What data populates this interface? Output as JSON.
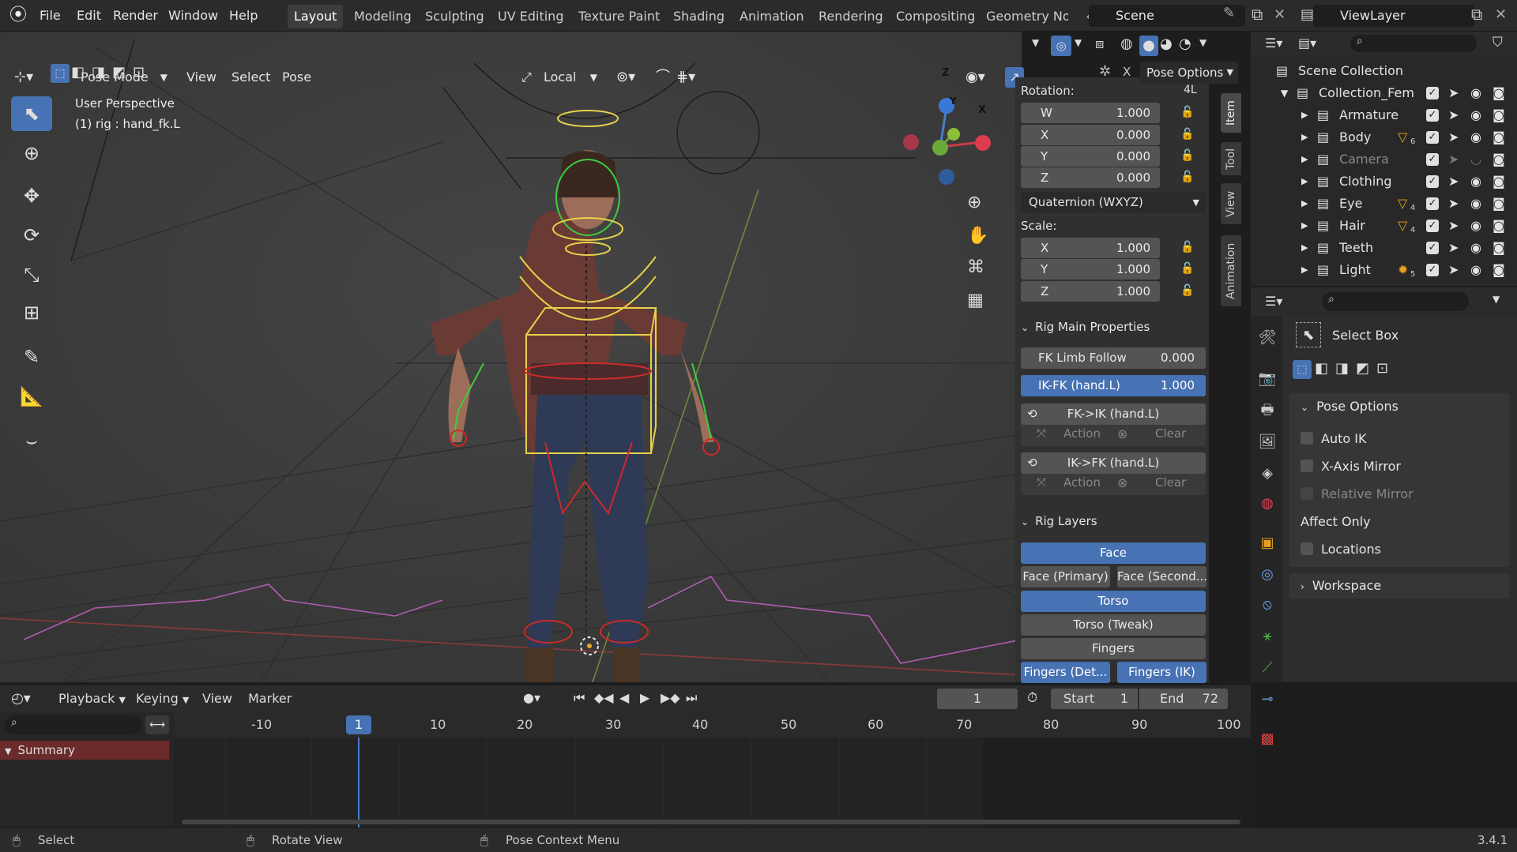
{
  "menus": [
    "File",
    "Edit",
    "Render",
    "Window",
    "Help"
  ],
  "workspaces": [
    "Layout",
    "Modeling",
    "Sculpting",
    "UV Editing",
    "Texture Paint",
    "Shading",
    "Animation",
    "Rendering",
    "Compositing",
    "Geometry Noc"
  ],
  "active_workspace": "Layout",
  "scene": "Scene",
  "view_layer": "ViewLayer",
  "viewport": {
    "mode": "Pose Mode",
    "view": "View",
    "select": "Select",
    "pose": "Pose",
    "orientation": "Local",
    "overlay_title": "User Perspective",
    "overlay_sub": "(1) rig : hand_fk.L",
    "gizmo_z": "Z",
    "gizmo_y": "Y",
    "gizmo_x": "X"
  },
  "npanel": {
    "pose_options_btn": "Pose Options",
    "x_label": "X",
    "rotation_label": "Rotation:",
    "rotation_mode_short": "4L",
    "rotation": [
      {
        "k": "W",
        "v": "1.000"
      },
      {
        "k": "X",
        "v": "0.000"
      },
      {
        "k": "Y",
        "v": "0.000"
      },
      {
        "k": "Z",
        "v": "0.000"
      }
    ],
    "rotation_mode": "Quaternion (WXYZ)",
    "scale_label": "Scale:",
    "scale": [
      {
        "k": "X",
        "v": "1.000"
      },
      {
        "k": "Y",
        "v": "1.000"
      },
      {
        "k": "Z",
        "v": "1.000"
      }
    ],
    "rig_main": "Rig Main Properties",
    "fk_limb_follow": {
      "k": "FK Limb Follow",
      "v": "0.000"
    },
    "ik_fk": {
      "k": "IK-FK (hand.L)",
      "v": "1.000"
    },
    "fk_to_ik": "FK->IK (hand.L)",
    "ik_to_fk": "IK->FK (hand.L)",
    "action": "Action",
    "clear": "Clear",
    "rig_layers": "Rig Layers",
    "layers": {
      "face": "Face",
      "face_primary": "Face (Primary)",
      "face_secondary": "Face (Second...",
      "torso": "Torso",
      "torso_tweak": "Torso (Tweak)",
      "fingers": "Fingers",
      "fingers_det": "Fingers (Det...",
      "fingers_ik": "Fingers (IK)"
    },
    "tabs": [
      "Item",
      "Tool",
      "View",
      "Animation"
    ]
  },
  "outliner": {
    "root": "Scene Collection",
    "collection": "Collection_Femal",
    "items": [
      {
        "name": "Armature",
        "badge": ""
      },
      {
        "name": "Body",
        "badge": "6"
      },
      {
        "name": "Camera",
        "badge": ""
      },
      {
        "name": "Clothing",
        "badge": ""
      },
      {
        "name": "Eye",
        "badge": "4"
      },
      {
        "name": "Hair",
        "badge": "4"
      },
      {
        "name": "Teeth",
        "badge": ""
      },
      {
        "name": "Light",
        "badge": "5"
      }
    ]
  },
  "properties": {
    "tool": "Select Box",
    "pose_options": "Pose Options",
    "auto_ik": "Auto IK",
    "x_mirror": "X-Axis Mirror",
    "relative_mirror": "Relative Mirror",
    "affect_only": "Affect Only",
    "locations": "Locations",
    "workspace": "Workspace"
  },
  "timeline": {
    "playback": "Playback",
    "keying": "Keying",
    "view": "View",
    "marker": "Marker",
    "current_frame": "1",
    "start_label": "Start",
    "start": "1",
    "end_label": "End",
    "end": "72",
    "ticks": [
      "-10",
      "10",
      "20",
      "30",
      "40",
      "50",
      "60",
      "70",
      "80",
      "90",
      "100"
    ],
    "cursor": "1",
    "summary": "Summary"
  },
  "status": {
    "select": "Select",
    "rotate": "Rotate View",
    "context": "Pose Context Menu",
    "version": "3.4.1"
  },
  "colors": {
    "accent": "#4772b3",
    "bg": "#303030"
  }
}
